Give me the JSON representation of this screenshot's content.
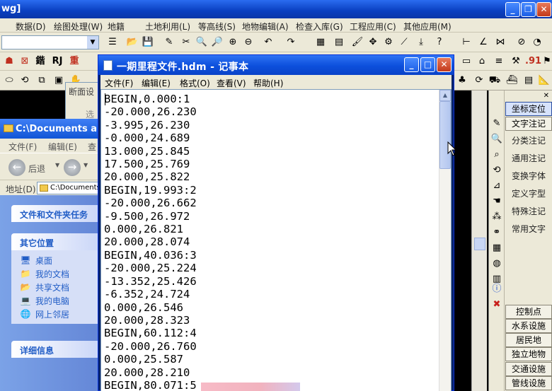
{
  "cad": {
    "title": "wg]",
    "menu": [
      "数据(D)",
      "绘图处理(W)",
      "地籍",
      "土地利用(L)",
      "等高线(S)",
      "地物编辑(A)",
      "检查入库(G)",
      "工程应用(C)",
      "其他应用(M)"
    ],
    "menu_partial_left": " ",
    "toolbar2_text": [
      "鍇",
      "RJ",
      "重",
      ".91"
    ],
    "right_panel": {
      "buttons": [
        "坐标定位",
        "文字注记",
        "分类注记",
        "通用注记",
        "变换字体",
        "定义字型",
        "特殊注记",
        "常用文字",
        "控制点",
        "水系设施",
        "居民地",
        "独立地物",
        "交通设施",
        "管线设施"
      ]
    }
  },
  "profile_dialog": {
    "title": "断面设",
    "body": "选"
  },
  "explorer": {
    "title": "C:\\Documents and",
    "menu": [
      "文件(F)",
      "编辑(E)",
      "查"
    ],
    "nav_back": "后退",
    "address_label": "地址(D)",
    "address_value": "C:\\Documents",
    "tasks_header": "文件和文件夹任务",
    "places_header": "其它位置",
    "places": [
      {
        "label": "桌面",
        "icon": "desktop-icon"
      },
      {
        "label": "我的文档",
        "icon": "my-documents-icon"
      },
      {
        "label": "共享文档",
        "icon": "shared-docs-icon"
      },
      {
        "label": "我的电脑",
        "icon": "my-computer-icon"
      },
      {
        "label": "网上邻居",
        "icon": "network-icon"
      }
    ],
    "details_header": "详细信息"
  },
  "notepad": {
    "title": "一期里程文件.hdm - 记事本",
    "menu": [
      "文件(F)",
      "编辑(E)",
      "格式(O)",
      "查看(V)",
      "帮助(H)"
    ],
    "lines": [
      "BEGIN,0.000:1",
      "-20.000,26.230",
      "-3.995,26.230",
      "-0.000,24.689",
      "13.000,25.845",
      "17.500,25.769",
      "20.000,25.822",
      "BEGIN,19.993:2",
      "-20.000,26.662",
      "-9.500,26.972",
      "0.000,26.821",
      "20.000,28.074",
      "BEGIN,40.036:3",
      "-20.000,25.224",
      "-13.352,25.426",
      "-6.352,24.724",
      "0.000,26.546",
      "20.000,28.323",
      "BEGIN,60.112:4",
      "-20.000,26.760",
      "0.000,25.587",
      "20.000,28.210",
      "BEGIN,80.071:5"
    ]
  }
}
